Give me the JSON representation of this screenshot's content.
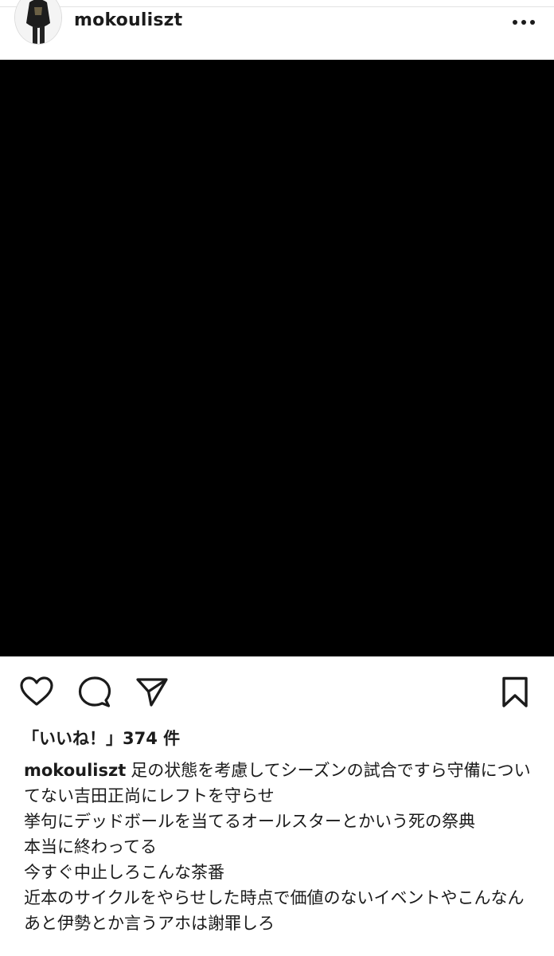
{
  "post": {
    "username": "mokouliszt",
    "likes_text": "「いいね！」374 件",
    "caption_username": "mokouliszt",
    "caption_lines": [
      "足の状態を考慮してシーズンの試合ですら守備についてない吉田正尚にレフトを守らせ",
      "挙句にデッドボールを当てるオールスターとかいう死の祭典",
      "本当に終わってる",
      "今すぐ中止しろこんな茶番",
      "近本のサイクルをやらせした時点で価値のないイベントやこんなん",
      "あと伊勢とか言うアホは謝罪しろ"
    ]
  },
  "icons": {
    "more": "more-options-icon",
    "like": "heart-icon",
    "comment": "comment-icon",
    "share": "send-icon",
    "save": "bookmark-icon"
  },
  "colors": {
    "text": "#1b1b1b",
    "media_background": "#000000",
    "page_background": "#ffffff"
  }
}
